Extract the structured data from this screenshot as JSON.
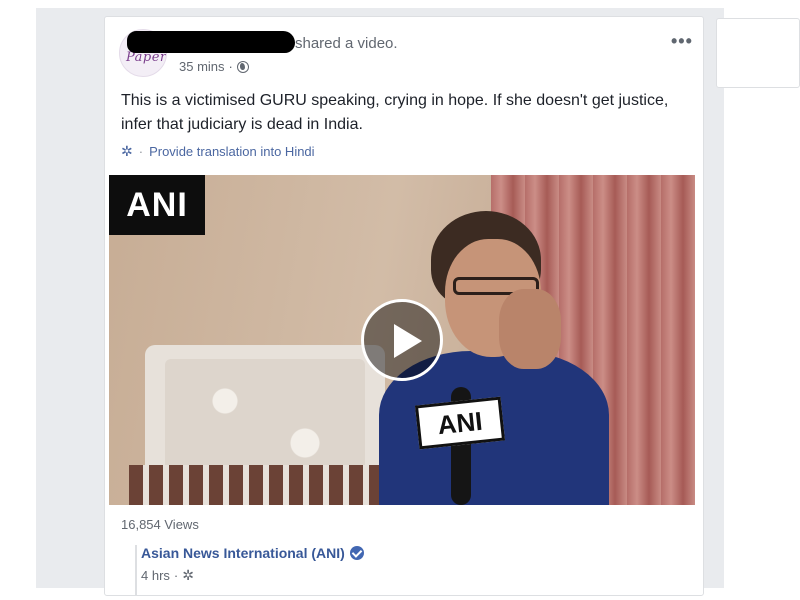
{
  "post": {
    "author_suffix": "shared a video.",
    "time": "35 mins",
    "time_sep": "·",
    "text": "This is a victimised GURU speaking, crying in hope. If she doesn't get justice, infer that judiciary is dead in India.",
    "translate_sep": "·",
    "translate_label": "Provide translation into Hindi",
    "more_label": "•••",
    "avatar_logo_text": "Paper"
  },
  "video": {
    "logo_text": "ANI",
    "mic_text": "ANI",
    "views": "16,854 Views"
  },
  "source": {
    "name": "Asian News International (ANI)",
    "time": "4 hrs",
    "time_sep": "·"
  },
  "icons": {
    "globe": "globe-icon",
    "gear": "gear-icon",
    "more": "more-options-icon",
    "play": "play-icon",
    "verified": "verified-badge-icon"
  },
  "colors": {
    "link": "#385898",
    "secondary_text": "#616770",
    "feed_background": "#e9ebee",
    "verified": "#4267b2"
  }
}
